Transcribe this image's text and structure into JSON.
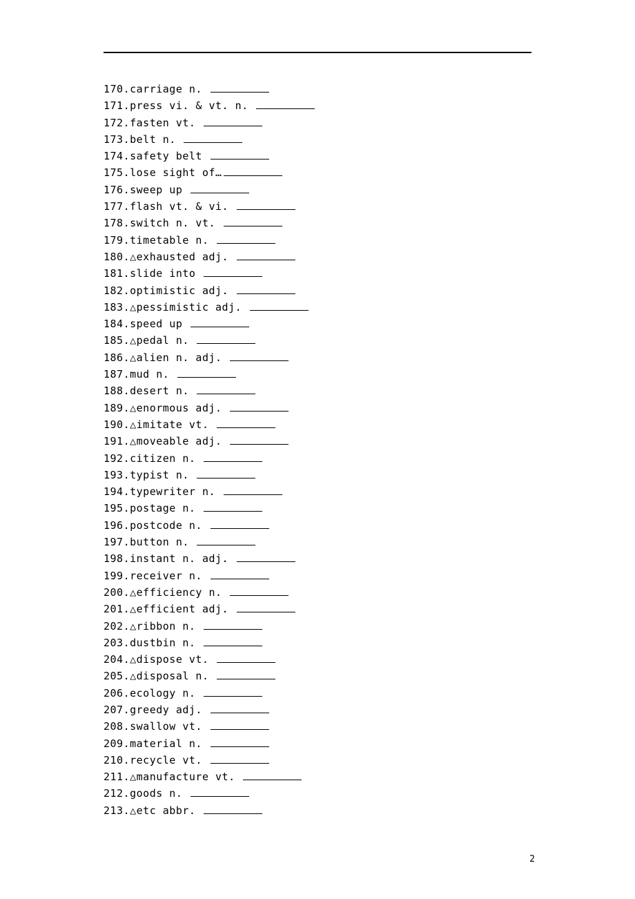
{
  "pageNumber": "2",
  "items": [
    {
      "num": "170",
      "text": "carriage  n.  "
    },
    {
      "num": "171",
      "text": "press  vi. & vt.  n.  "
    },
    {
      "num": "172",
      "text": "fasten  vt.  "
    },
    {
      "num": "173",
      "text": "belt  n.  "
    },
    {
      "num": "174",
      "text": "safety belt "
    },
    {
      "num": "175",
      "text": "lose sight of…"
    },
    {
      "num": "176",
      "text": "sweep up "
    },
    {
      "num": "177",
      "text": "flash  vt. & vi.  "
    },
    {
      "num": "178",
      "text": "switch  n.  vt.  "
    },
    {
      "num": "179",
      "text": "timetable  n.  "
    },
    {
      "num": "180",
      "text": "△exhausted  adj. "
    },
    {
      "num": "181",
      "text": "slide into "
    },
    {
      "num": "182",
      "text": "optimistic  adj.  "
    },
    {
      "num": "183",
      "text": "△pessimistic  adj.  "
    },
    {
      "num": "184",
      "text": "speed up  "
    },
    {
      "num": "185",
      "text": "△pedal  n.  "
    },
    {
      "num": "186",
      "text": "△alien  n.  adj.  "
    },
    {
      "num": "187",
      "text": "mud  n.  "
    },
    {
      "num": "188",
      "text": "desert  n.   "
    },
    {
      "num": "189",
      "text": "△enormous  adj.  "
    },
    {
      "num": "190",
      "text": "△imitate  vt.  "
    },
    {
      "num": "191",
      "text": "△moveable  adj.  "
    },
    {
      "num": "192",
      "text": "citizen  n.  "
    },
    {
      "num": "193",
      "text": "typist  n.  "
    },
    {
      "num": "194",
      "text": "typewriter  n.  "
    },
    {
      "num": "195",
      "text": "postage  n.  "
    },
    {
      "num": "196",
      "text": "postcode  n.  "
    },
    {
      "num": "197",
      "text": "button  n.  "
    },
    {
      "num": "198",
      "text": "instant  n.  adj. "
    },
    {
      "num": "199",
      "text": "receiver  n.  "
    },
    {
      "num": "200",
      "text": "△efficiency  n.  "
    },
    {
      "num": "201",
      "text": "△efficient  adj.  "
    },
    {
      "num": "202",
      "text": "△ribbon  n.  "
    },
    {
      "num": "203",
      "text": "dustbin  n.  "
    },
    {
      "num": "204",
      "text": "△dispose  vt.  "
    },
    {
      "num": "205",
      "text": "△disposal  n.  "
    },
    {
      "num": "206",
      "text": "ecology  n.   "
    },
    {
      "num": "207",
      "text": "greedy  adj.  "
    },
    {
      "num": "208",
      "text": "swallow  vt.  "
    },
    {
      "num": "209",
      "text": "material  n.  "
    },
    {
      "num": "210",
      "text": "recycle  vt.  "
    },
    {
      "num": "211",
      "text": "△manufacture  vt. "
    },
    {
      "num": "212",
      "text": "goods n.  "
    },
    {
      "num": "213",
      "text": "△etc  abbr.  "
    }
  ]
}
